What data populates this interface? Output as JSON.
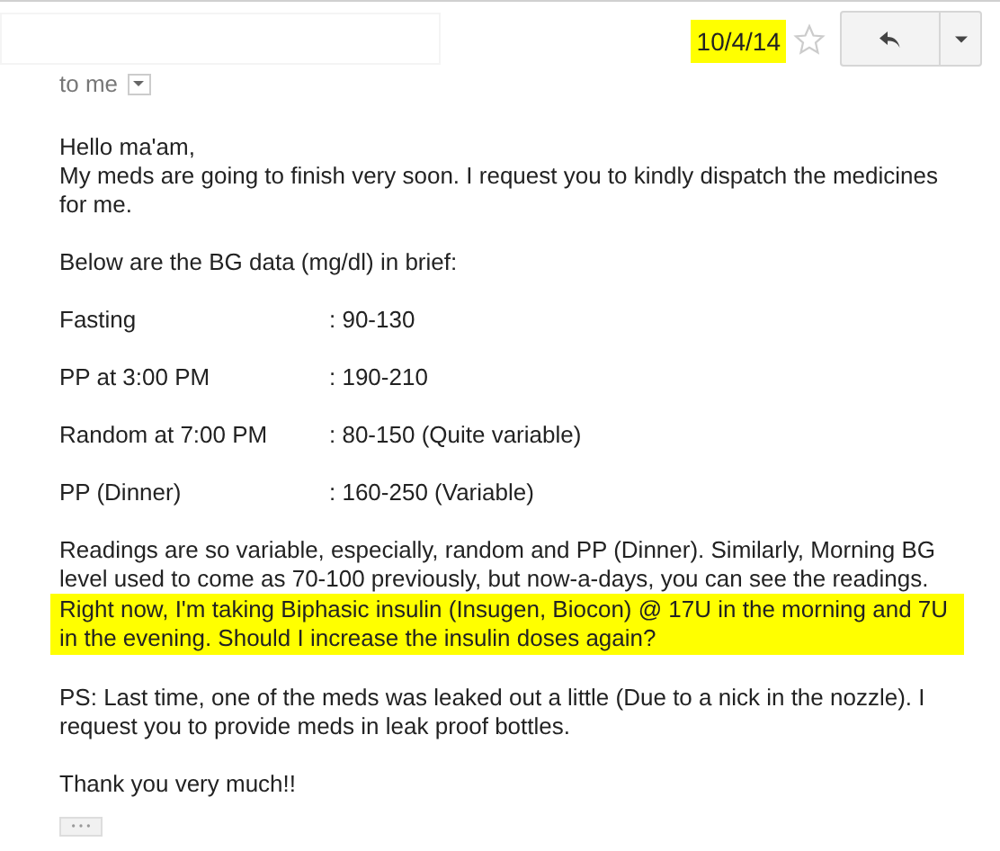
{
  "header": {
    "date": "10/4/14",
    "date_highlighted": true,
    "starred": false,
    "recipient": "to me"
  },
  "body": [
    {
      "kind": "paragraph",
      "lines": [
        {
          "text": "Hello ma'am,",
          "highlighted": false
        },
        {
          "text": "My meds are going to finish very soon. I request you to kindly dispatch the medicines for me.",
          "highlighted": false
        }
      ]
    },
    {
      "kind": "paragraph",
      "lines": [
        {
          "text": "Below are the BG data (mg/dl) in brief:",
          "highlighted": false
        }
      ]
    },
    {
      "kind": "reading",
      "label": "Fasting",
      "value": ": 90-130"
    },
    {
      "kind": "reading",
      "label": "PP at 3:00 PM",
      "value": ": 190-210"
    },
    {
      "kind": "reading",
      "label": "Random at 7:00 PM",
      "value": ": 80-150 (Quite variable)"
    },
    {
      "kind": "reading",
      "label": "PP (Dinner)",
      "value": ": 160-250 (Variable)"
    },
    {
      "kind": "paragraph",
      "lines": [
        {
          "text": "Readings are so variable, especially, random and PP (Dinner). Similarly, Morning BG level used to come as 70-100 previously, but now-a-days, you can see the readings.",
          "highlighted": false
        },
        {
          "text": "Right now, I'm taking Biphasic insulin (Insugen, Biocon) @ 17U in the morning and 7U in the evening. Should I increase the insulin doses again?",
          "highlighted": true
        }
      ]
    },
    {
      "kind": "paragraph",
      "lines": [
        {
          "text": "PS: Last time, one of the meds was leaked out a little (Due to a nick in the nozzle). I request you to provide meds in leak proof bottles.",
          "highlighted": false
        }
      ]
    },
    {
      "kind": "paragraph",
      "lines": [
        {
          "text": "Thank you very much!!",
          "highlighted": false
        }
      ]
    }
  ]
}
